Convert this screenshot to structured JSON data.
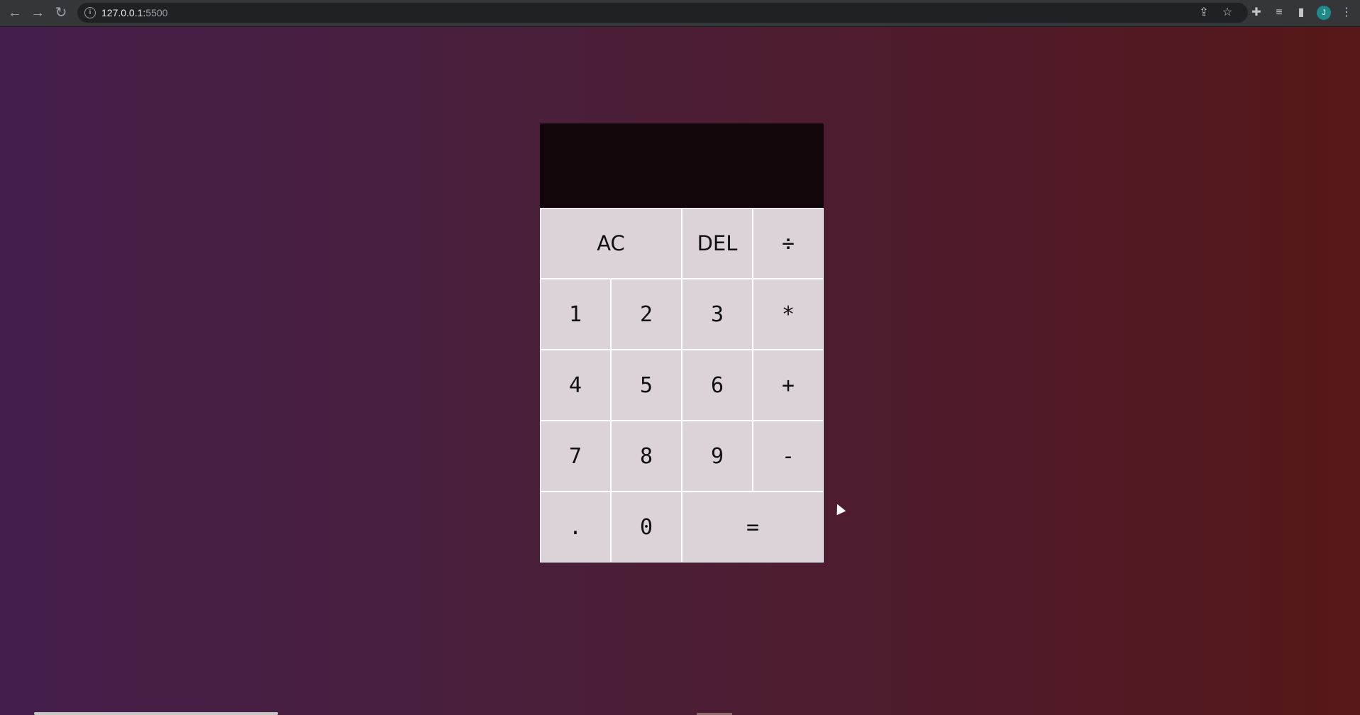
{
  "browser": {
    "url_host": "127.0.0.1:",
    "url_port": "5500",
    "avatar_letter": "J"
  },
  "calculator": {
    "display_previous": "",
    "display_current": "",
    "keys": {
      "ac": "AC",
      "del": "DEL",
      "divide": "÷",
      "one": "1",
      "two": "2",
      "three": "3",
      "multiply": "*",
      "four": "4",
      "five": "5",
      "six": "6",
      "add": "+",
      "seven": "7",
      "eight": "8",
      "nine": "9",
      "subtract": "-",
      "decimal": ".",
      "zero": "0",
      "equals": "="
    }
  }
}
